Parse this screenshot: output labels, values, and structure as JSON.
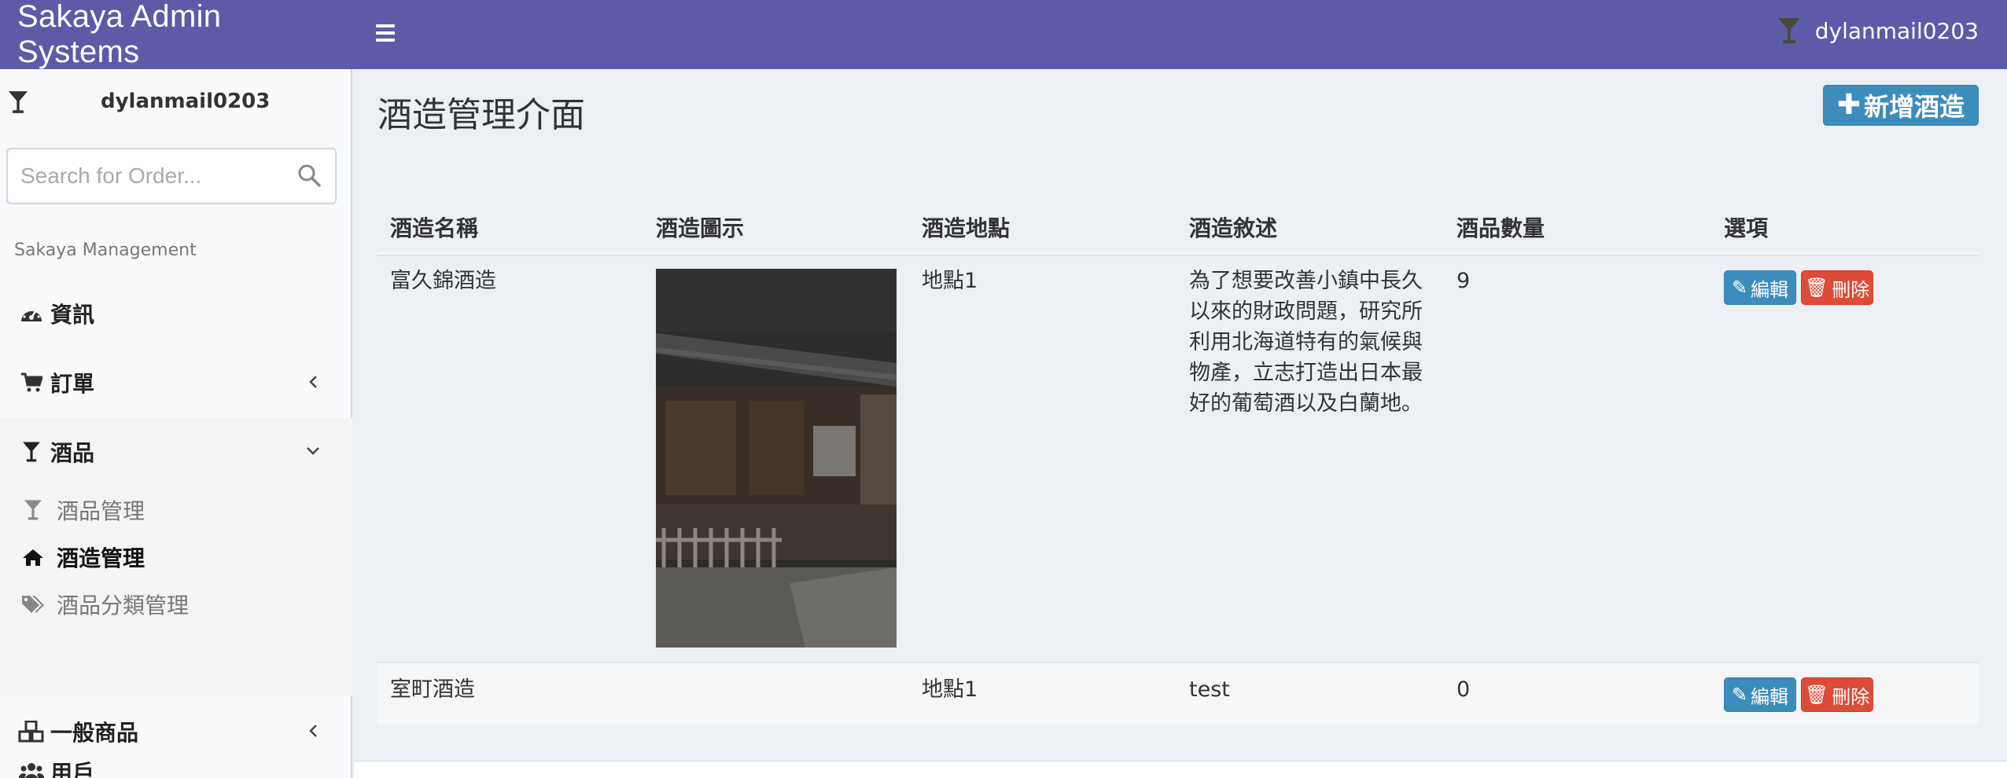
{
  "header": {
    "brand": "Sakaya Admin Systems",
    "username": "dylanmail0203"
  },
  "sidebar": {
    "username": "dylanmail0203",
    "search": {
      "placeholder": "Search for Order...",
      "value": ""
    },
    "section_header": "Sakaya Management",
    "items": [
      {
        "label": "資訊",
        "icon": "dashboard-icon"
      },
      {
        "label": "訂單",
        "icon": "cart-icon",
        "caret": "left"
      },
      {
        "label": "酒品",
        "icon": "glass-icon",
        "caret": "down"
      },
      {
        "label": "一般商品",
        "icon": "cubes-icon",
        "caret": "left"
      },
      {
        "label": "用戶",
        "icon": "users-icon"
      }
    ],
    "subitems": [
      {
        "label": "酒品管理",
        "icon": "glass-icon"
      },
      {
        "label": "酒造管理",
        "icon": "home-icon",
        "active": true
      },
      {
        "label": "酒品分類管理",
        "icon": "tags-icon"
      }
    ]
  },
  "main": {
    "title": "酒造管理介面",
    "add_button": "新增酒造",
    "columns": [
      "酒造名稱",
      "酒造圖示",
      "酒造地點",
      "酒造敘述",
      "酒品數量",
      "選項"
    ],
    "rows": [
      {
        "name": "富久錦酒造",
        "has_image": true,
        "location": "地點1",
        "description": "為了想要改善小鎮中長久以來的財政問題，研究所利用北海道特有的氣候與物產，立志打造出日本最好的葡萄酒以及白蘭地。",
        "count": "9",
        "edit_label": "編輯",
        "delete_label": "刪除"
      },
      {
        "name": "室町酒造",
        "has_image": false,
        "location": "地點1",
        "description": "test",
        "count": "0",
        "edit_label": "編輯",
        "delete_label": "刪除"
      }
    ]
  },
  "colors": {
    "header_bg": "#5d5ba8",
    "primary": "#3c8dbc",
    "danger": "#dd4b39",
    "content_bg": "#ecf0f5"
  }
}
